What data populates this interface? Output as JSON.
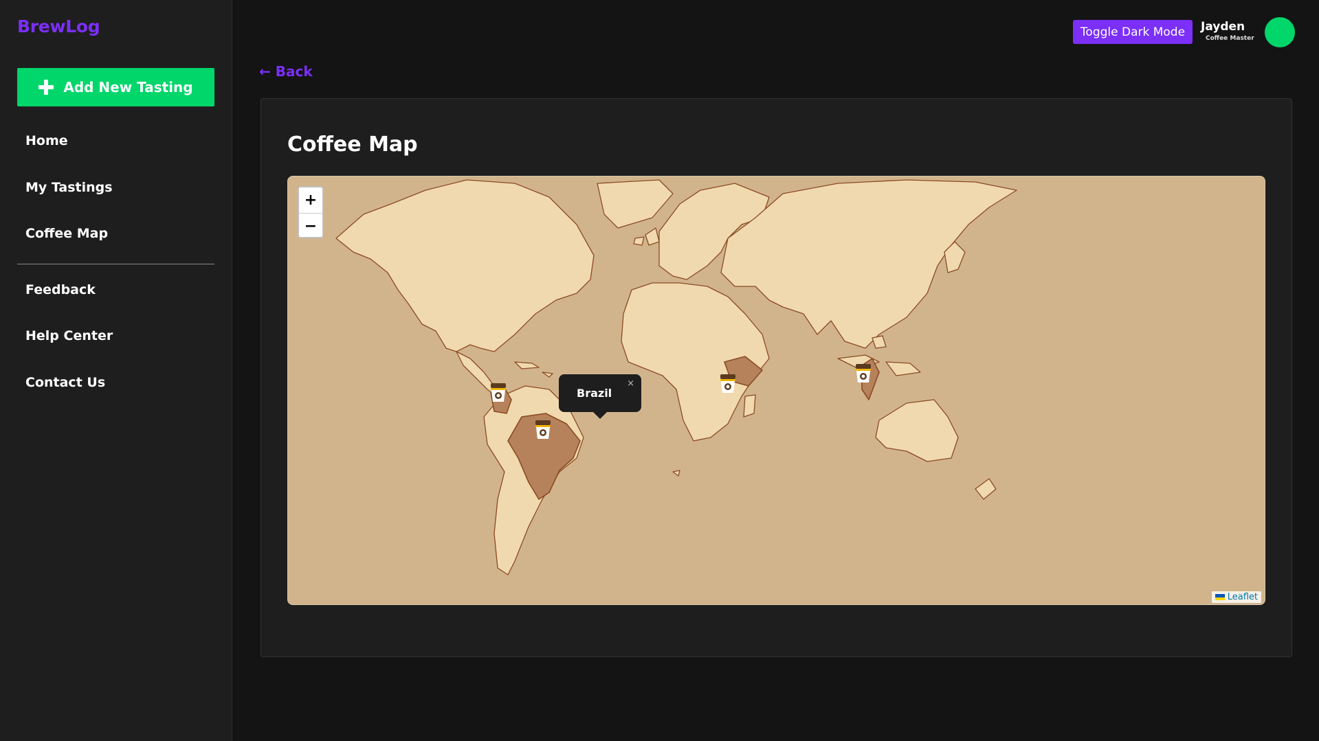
{
  "sidebar": {
    "logo": "BrewLog",
    "add_button": {
      "label": "Add New Tasting",
      "icon": "plus-icon"
    },
    "nav_items": [
      {
        "label": "Home"
      },
      {
        "label": "My Tastings"
      },
      {
        "label": "Coffee Map"
      }
    ],
    "secondary_items": [
      {
        "label": "Feedback"
      },
      {
        "label": "Help Center"
      },
      {
        "label": "Contact Us"
      }
    ]
  },
  "header": {
    "toggle_label": "Toggle Dark Mode",
    "user_name": "Jayden",
    "user_role": "Coffee Master"
  },
  "back_label": "← Back",
  "page_title": "Coffee Map",
  "map": {
    "zoom_in": "+",
    "zoom_out": "−",
    "popup_title": "Brazil",
    "popup_close": "×",
    "attribution": "Leaflet",
    "markers": [
      "coffee-cup-marker",
      "coffee-cup-marker",
      "coffee-cup-marker",
      "coffee-cup-marker"
    ]
  },
  "colors": {
    "accent_purple": "#7b2ff7",
    "accent_green": "#00d66a",
    "ocean": "#d1b48c",
    "land": "#f0d9ae",
    "highlight_land": "#b5825c",
    "border": "#8b4a22"
  }
}
